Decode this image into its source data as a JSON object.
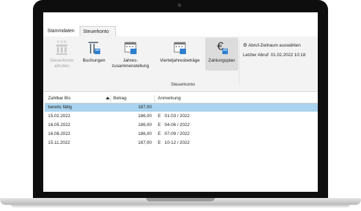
{
  "tabs": [
    {
      "label": "Stammdaten",
      "active": false
    },
    {
      "label": "Steuerkonto",
      "active": true
    }
  ],
  "ribbon": {
    "buttons": [
      {
        "line1": "Steuerkonto",
        "line2": "abrufen",
        "icon": "fon-database-icon",
        "disabled": true
      },
      {
        "line1": "Buchungen",
        "line2": "",
        "icon": "bookings-table-icon"
      },
      {
        "line1": "Jahres-",
        "line2": "zusammenstellung",
        "icon": "calendar-year-icon"
      },
      {
        "line1": "Vierteljahresbeträge",
        "line2": "",
        "icon": "calendar-quarter-icon"
      },
      {
        "line1": "Zahlungsplan",
        "line2": "",
        "icon": "euro-plan-icon",
        "selected": true
      }
    ],
    "group_label": "Steuerkonto",
    "abruf_link": "Abruf-Zeitraum auswählen",
    "letzter_abruf": "Letzter Abruf: 01.02.2022 10:18"
  },
  "grid": {
    "columns": [
      "Zahlbar Bis",
      "Betrag",
      "Anmerkung"
    ],
    "sort_column": "Zahlbar Bis",
    "rows": [
      {
        "date": "bereits fällig",
        "amount": "187,00",
        "note": "",
        "selected": true
      },
      {
        "date": "15.02.2022",
        "amount": "186,00",
        "note": "E   01-03 / 2022"
      },
      {
        "date": "16.05.2022",
        "amount": "186,00",
        "note": "E   04-06 / 2022"
      },
      {
        "date": "16.08.2022",
        "amount": "186,00",
        "note": "E   07-09 / 2022"
      },
      {
        "date": "15.11.2022",
        "amount": "187,00",
        "note": "E   10-12 / 2022"
      }
    ]
  },
  "colors": {
    "selection": "#a9d3ee",
    "ribbon_bg": "#f3f3f3",
    "bezel": "#0e0e0e"
  }
}
